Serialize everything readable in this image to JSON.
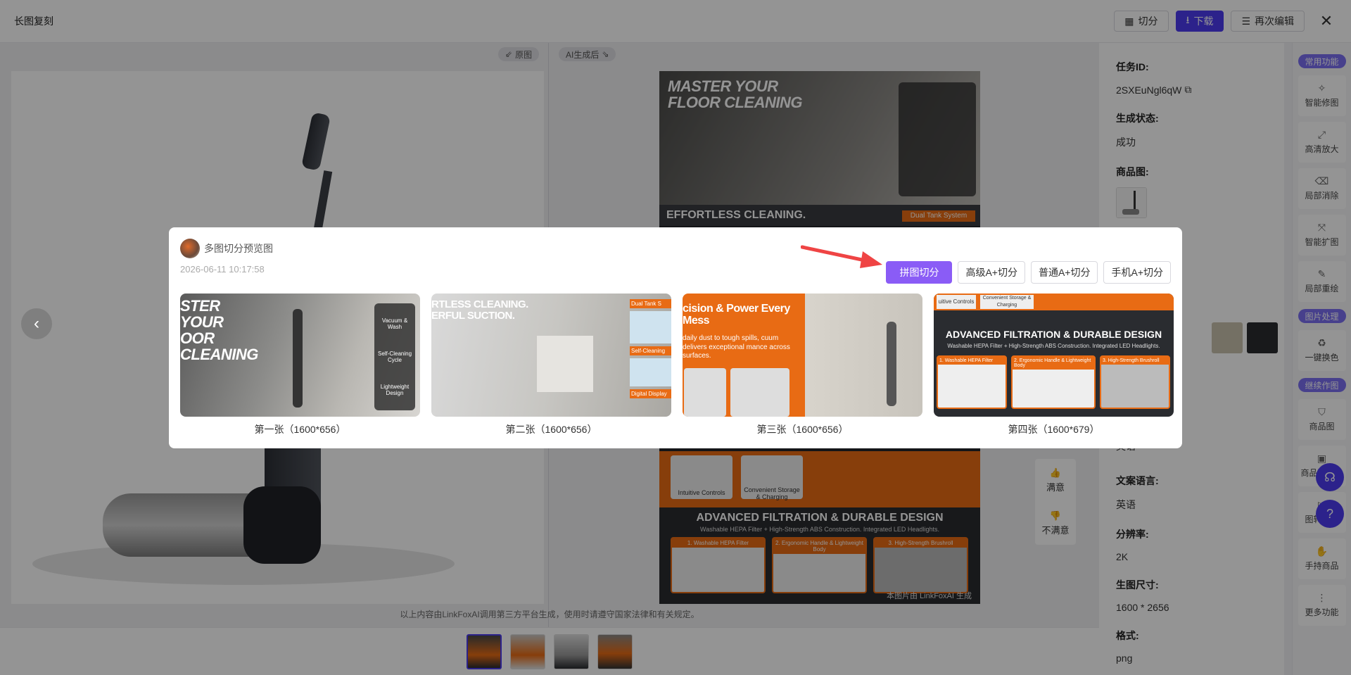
{
  "header": {
    "title": "长图复刻",
    "cut_label": "切分",
    "download_label": "下载",
    "reedit_label": "再次编辑",
    "close_label": "✕"
  },
  "compare": {
    "left_tag": "原图",
    "right_tag": "AI生成后",
    "right_headline": "MASTER YOUR FLOOR CLEANING",
    "right_mid": "EFFORTLESS CLEANING.",
    "right_tank": "Dual Tank System",
    "right_bottom": "ADVANCED FILTRATION & DURABLE DESIGN",
    "right_bottom_sub": "Washable HEPA Filter + High-Strength ABS Construction. Integrated LED Headlights.",
    "right_features": [
      "1. Washable HEPA Filter",
      "2. Ergonomic Handle & Lightweight Body",
      "3. High-Strength Brushroll"
    ],
    "right_controls": [
      "Intuitive Controls",
      "Convenient Storage & Charging"
    ],
    "watermark": "本图片由 LinkFoxAI 生成",
    "disclaimer": "以上内容由LinkFoxAI调用第三方平台生成，使用时请遵守国家法律和有关规定。",
    "feedback_good": "满意",
    "feedback_bad": "不满意"
  },
  "info": {
    "task_id_label": "任务ID:",
    "task_id": "2SXEuNgl6qW",
    "status_label": "生成状态:",
    "status": "成功",
    "product_label": "商品图:",
    "lang_partial": "英语",
    "copy_lang_label": "文案语言:",
    "copy_lang": "英语",
    "resolution_label": "分辨率:",
    "resolution": "2K",
    "size_label": "生图尺寸:",
    "size": "1600 * 2656",
    "format_label": "格式:",
    "format": "png"
  },
  "tools": {
    "group1": "常用功能",
    "items1": [
      "智能修图",
      "高清放大",
      "局部消除",
      "智能扩图",
      "局部重绘"
    ],
    "group2": "图片处理",
    "items2": [
      "一键换色"
    ],
    "group3": "继续作图",
    "items3": [
      "商品图",
      "商品图设计",
      "图转视频",
      "手持商品",
      "更多功能"
    ]
  },
  "modal": {
    "title": "多图切分预览图",
    "date": "2026-06-11 10:17:58",
    "btn_stitch": "拼图切分",
    "btn_adv": "高级A+切分",
    "btn_normal": "普通A+切分",
    "btn_mobile": "手机A+切分",
    "slices": [
      {
        "caption": "第一张（1600*656）",
        "headline": "STER YOUR OOR CLEANING",
        "features": [
          "Vacuum & Wash",
          "Self-Cleaning Cycle",
          "Lightweight Design"
        ]
      },
      {
        "caption": "第二张（1600*656）",
        "headline": "RTLESS CLEANING. ERFUL SUCTION.",
        "features": [
          "Dual Tank S",
          "Self-Cleaning",
          "Digital Display"
        ]
      },
      {
        "caption": "第三张（1600*656）",
        "headline": "cision & Power Every Mess",
        "sub": "daily dust to tough spills, cuum delivers exceptional mance across surfaces."
      },
      {
        "caption": "第四张（1600*679）",
        "headline": "ADVANCED FILTRATION & DURABLE DESIGN",
        "sub": "Washable HEPA Filter + High-Strength ABS Construction. Integrated LED Headlights.",
        "top": [
          "uitive Controls",
          "Convenient Storage & Charging"
        ],
        "features": [
          "1. Washable HEPA Filter",
          "2. Ergonomic Handle & Lightweight Body",
          "3. High-Strength Brushroll"
        ]
      }
    ]
  }
}
